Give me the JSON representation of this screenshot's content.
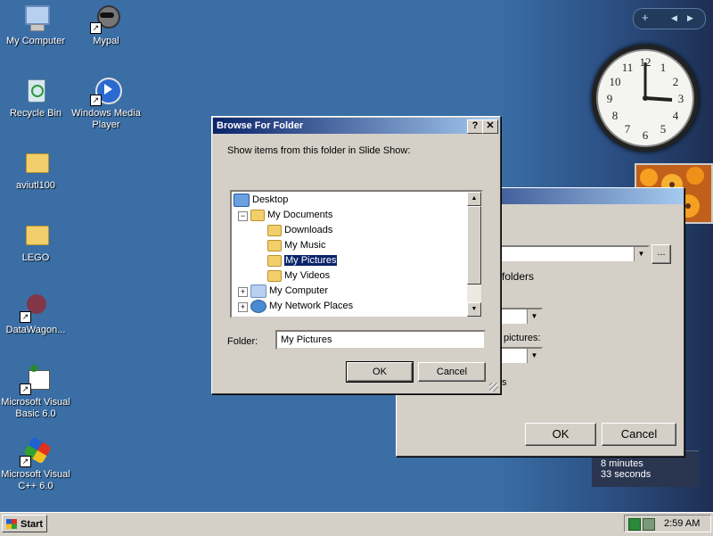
{
  "desktop": {
    "icons": [
      {
        "label": "My Computer"
      },
      {
        "label": "Mypal"
      },
      {
        "label": "Recycle Bin"
      },
      {
        "label": "Windows Media Player"
      },
      {
        "label": "aviutl100"
      },
      {
        "label": "LEGO"
      },
      {
        "label": "DataWagon..."
      },
      {
        "label": "Microsoft Visual Basic 6.0"
      },
      {
        "label": "Microsoft Visual C++ 6.0"
      }
    ]
  },
  "sidebar": {
    "timer_line1": "8 minutes",
    "timer_line2": "33 seconds"
  },
  "settings_dialog": {
    "folders_label": "folders",
    "pictures_label": "pictures:",
    "partial_text": "s",
    "browse_label": "...",
    "ok_label": "OK",
    "cancel_label": "Cancel"
  },
  "browse_dialog": {
    "title": "Browse For Folder",
    "help_label": "?",
    "close_label": "✕",
    "instruction": "Show items from this folder in Slide Show:",
    "tree": [
      {
        "label": "Desktop"
      },
      {
        "label": "My Documents"
      },
      {
        "label": "Downloads"
      },
      {
        "label": "My Music"
      },
      {
        "label": "My Pictures"
      },
      {
        "label": "My Videos"
      },
      {
        "label": "My Computer"
      },
      {
        "label": "My Network Places"
      }
    ],
    "folder_label": "Folder:",
    "folder_value": "My Pictures",
    "ok_label": "OK",
    "cancel_label": "Cancel"
  },
  "taskbar": {
    "start_label": "Start",
    "clock": "2:59 AM"
  }
}
